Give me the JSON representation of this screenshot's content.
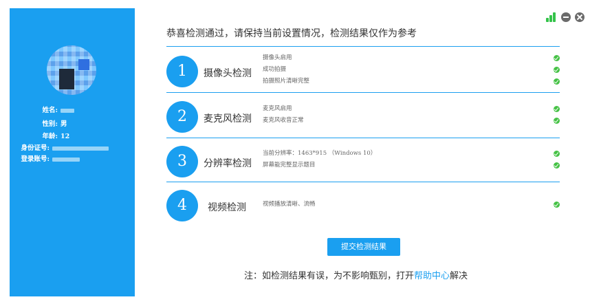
{
  "header": {
    "message": "恭喜检测通过，请保持当前设置情况，检测结果仅作为参考"
  },
  "window_controls": {
    "signal_icon": "signal-bars-icon",
    "minimize_icon": "minimize-icon",
    "close_icon": "close-icon",
    "signal_color": "#34c34a"
  },
  "profile": {
    "avatar_icon": "avatar-pixelated",
    "labels": {
      "name": "姓名:",
      "gender": "性别:",
      "age": "年龄:",
      "id_number": "身份证号:",
      "account": "登录账号:"
    },
    "values": {
      "gender": "男",
      "age": "12"
    }
  },
  "sections": [
    {
      "number": "1",
      "title": "摄像头检测",
      "items": [
        "摄像头启用",
        "成功拍摄",
        "拍摄照片清晰完整"
      ]
    },
    {
      "number": "2",
      "title": "麦克风检测",
      "items": [
        "麦克风启用",
        "麦克风收音正常"
      ]
    },
    {
      "number": "3",
      "title": "分辨率检测",
      "items": [
        "当前分辨率：1463*915 （Windows 10）",
        "屏幕能完整显示题目"
      ]
    },
    {
      "number": "4",
      "title": "视频检测",
      "items": [
        "视频播放清晰、流畅"
      ]
    }
  ],
  "actions": {
    "submit_label": "提交检测结果"
  },
  "footer": {
    "prefix": "注：如检测结果有误，为不影响甄别，打开",
    "link": "帮助中心",
    "suffix": "解决"
  },
  "colors": {
    "primary": "#1a9ff0",
    "success": "#46c246",
    "sidebar": "#1a9ff0"
  }
}
